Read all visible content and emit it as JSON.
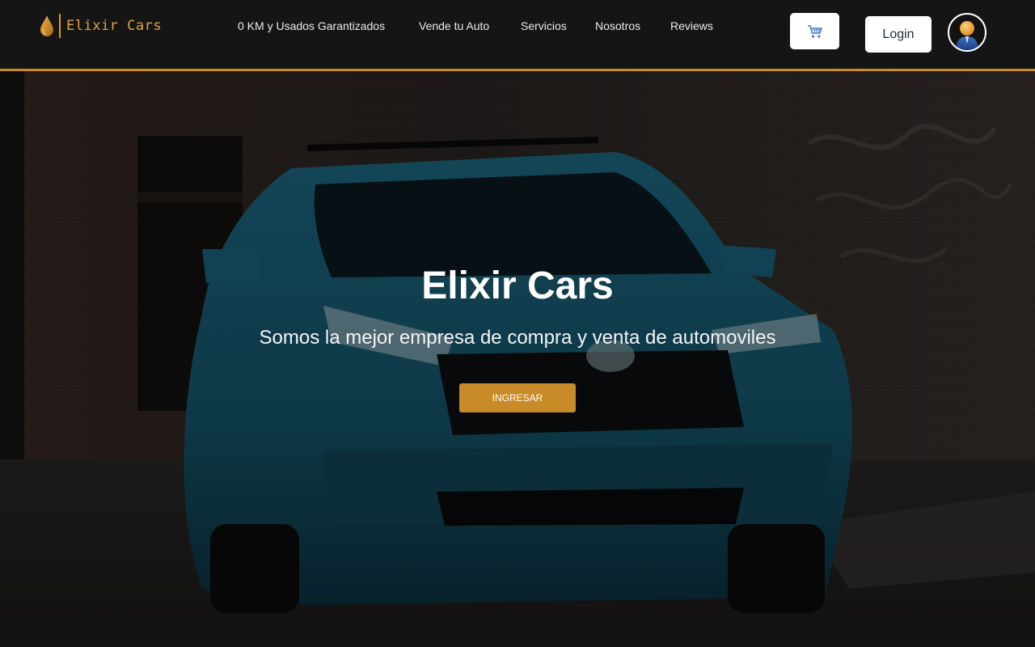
{
  "brand": {
    "name": "Elixir Cars",
    "logo_icon": "drop-icon",
    "accent_color": "#c98a28"
  },
  "nav": {
    "items": [
      {
        "label": "0 KM y Usados Garantizados"
      },
      {
        "label": "Vende tu Auto"
      },
      {
        "label": "Servicios"
      },
      {
        "label": "Nosotros"
      },
      {
        "label": "Reviews"
      }
    ]
  },
  "header": {
    "cart_icon": "cart-icon",
    "cart_glyph": "🛒",
    "login_label": "Login",
    "avatar_icon": "user-avatar-icon"
  },
  "hero": {
    "title": "Elixir Cars",
    "subtitle": "Somos la mejor empresa de compra y venta de automoviles",
    "cta_label": "INGRESAR",
    "background_image": "blue suv in graffiti alley"
  }
}
